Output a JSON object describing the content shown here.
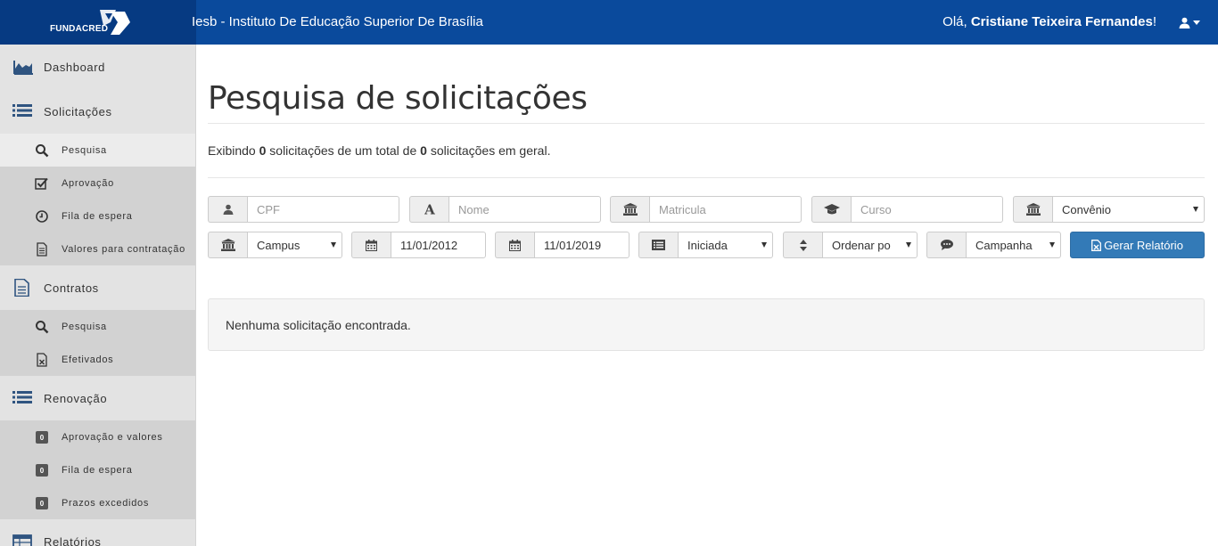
{
  "colors": {
    "topbar": "#0a4a9c",
    "brand": "#063a82",
    "primary_button": "#337ab7",
    "sidebar": "#e6e6e6"
  },
  "header": {
    "brand": "FUNDACRED",
    "institution": "Iesb - Instituto De Educação Superior De Brasília",
    "greeting_prefix": "Olá, ",
    "user_name": "Cristiane Teixeira Fernandes",
    "greeting_suffix": "!",
    "user_icon": "user-icon"
  },
  "sidebar": {
    "dashboard": {
      "label": "Dashboard",
      "icon": "area-chart-icon"
    },
    "solicitacoes": {
      "label": "Solicitações",
      "icon": "list-icon",
      "items": [
        {
          "label": "Pesquisa",
          "icon": "search-icon"
        },
        {
          "label": "Aprovação",
          "icon": "check-square-icon"
        },
        {
          "label": "Fila de espera",
          "icon": "clock-icon"
        },
        {
          "label": "Valores para contratação",
          "icon": "file-text-icon"
        }
      ]
    },
    "contratos": {
      "label": "Contratos",
      "icon": "file-text-icon",
      "items": [
        {
          "label": "Pesquisa",
          "icon": "search-icon"
        },
        {
          "label": "Efetivados",
          "icon": "file-excel-icon"
        }
      ]
    },
    "renovacao": {
      "label": "Renovação",
      "icon": "list-icon",
      "items": [
        {
          "label": "Aprovação e valores",
          "badge": "0"
        },
        {
          "label": "Fila de espera",
          "badge": "0"
        },
        {
          "label": "Prazos excedidos",
          "badge": "0"
        }
      ]
    },
    "relatorios": {
      "label": "Relatórios",
      "icon": "table-icon"
    }
  },
  "main": {
    "title": "Pesquisa de solicitações",
    "summary": {
      "p1": "Exibindo ",
      "shown": "0",
      "p2": " solicitações de um total de ",
      "total": "0",
      "p3": " solicitações em geral."
    },
    "filters": {
      "cpf": {
        "placeholder": "CPF",
        "icon": "user-icon"
      },
      "nome": {
        "placeholder": "Nome",
        "icon": "font-icon"
      },
      "matricula": {
        "placeholder": "Matricula",
        "icon": "institution-icon"
      },
      "curso": {
        "placeholder": "Curso",
        "icon": "graduation-cap-icon"
      },
      "convenio": {
        "value": "Convênio",
        "icon": "institution-icon"
      },
      "campus": {
        "value": "Campus",
        "icon": "institution-icon"
      },
      "date_start": {
        "value": "11/01/2012",
        "icon": "calendar-icon"
      },
      "date_end": {
        "value": "11/01/2019",
        "icon": "calendar-icon"
      },
      "status": {
        "value": "Iniciada",
        "icon": "list-alt-icon"
      },
      "order": {
        "value": "Ordenar po",
        "icon": "sort-icon"
      },
      "campanha": {
        "value": "Campanha",
        "icon": "comment-icon"
      }
    },
    "report_button": "Gerar Relatório",
    "empty_message": "Nenhuma solicitação encontrada."
  }
}
